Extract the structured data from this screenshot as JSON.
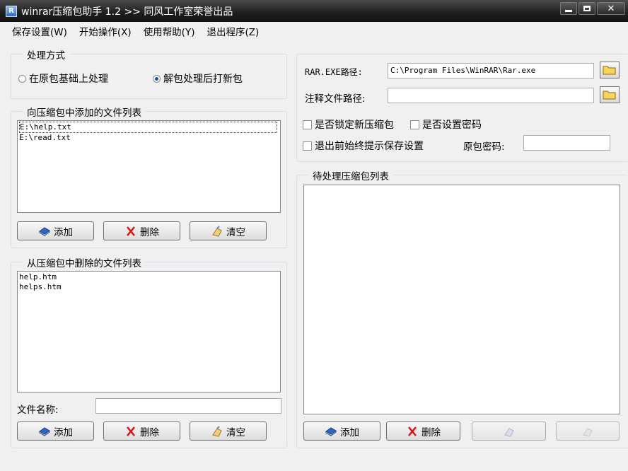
{
  "window": {
    "title": "winrar压缩包助手 1.2  >> 同风工作室荣誉出品",
    "app_icon": "rar-app-icon",
    "controls": [
      "minimize-icon",
      "maximize-icon",
      "close-icon"
    ]
  },
  "menu": [
    {
      "label": "保存设置(W)"
    },
    {
      "label": "开始操作(X)"
    },
    {
      "label": "使用帮助(Y)"
    },
    {
      "label": "退出程序(Z)"
    }
  ],
  "mode": {
    "legend": "处理方式",
    "option1": "在原包基础上处理",
    "option2": "解包处理后打新包",
    "selected": "option2"
  },
  "add_list": {
    "legend": "向压缩包中添加的文件列表",
    "items": [
      "E:\\help.txt",
      "E:\\read.txt"
    ],
    "selected_index": 0,
    "buttons": {
      "add": "添加",
      "delete": "删除",
      "clear": "清空"
    }
  },
  "delete_list": {
    "legend": "从压缩包中删除的文件列表",
    "items": [
      "help.htm",
      "helps.htm"
    ],
    "filename_label": "文件名称:",
    "filename_value": "",
    "buttons": {
      "add": "添加",
      "delete": "删除",
      "clear": "清空"
    }
  },
  "settings": {
    "rar_path_label": "RAR.EXE路径:",
    "rar_path_value": "C:\\Program Files\\WinRAR\\Rar.exe",
    "comment_label": "注释文件路径:",
    "comment_value": "",
    "lock_label": "是否锁定新压缩包",
    "password_label": "是否设置密码",
    "prompt_label": "退出前始终提示保存设置",
    "orig_pwd_label": "原包密码:",
    "orig_pwd_value": ""
  },
  "pending": {
    "legend": "待处理压缩包列表",
    "items": [],
    "buttons": {
      "add": "添加",
      "delete": "删除"
    }
  }
}
